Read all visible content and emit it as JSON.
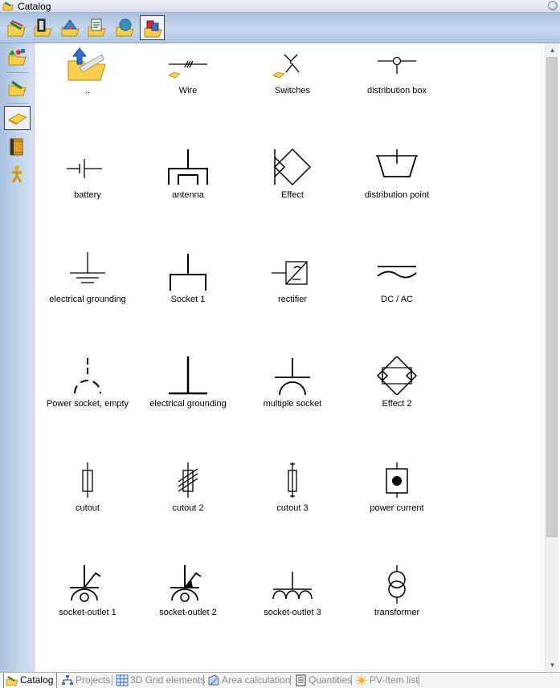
{
  "window": {
    "title": "Catalog"
  },
  "toolbar": {
    "buttons": [
      {
        "icon": "catalog-folder-icon"
      },
      {
        "icon": "door-folder-icon"
      },
      {
        "icon": "roof-folder-icon"
      },
      {
        "icon": "document-folder-icon"
      },
      {
        "icon": "globe-folder-icon"
      },
      {
        "icon": "electrical-folder-icon",
        "active": true
      }
    ]
  },
  "sidebar": {
    "buttons": [
      {
        "icon": "shapes-folder-icon"
      },
      {
        "icon": "folder-open-icon"
      },
      {
        "icon": "folder-small-icon",
        "active": true
      },
      {
        "icon": "book-icon"
      },
      {
        "icon": "person-icon"
      }
    ]
  },
  "items": [
    {
      "label": "..",
      "icon": "parent-folder-up-icon"
    },
    {
      "label": "Wire",
      "icon": "wire-symbol-icon"
    },
    {
      "label": "Switches",
      "icon": "switch-symbol-icon"
    },
    {
      "label": "distribution box",
      "icon": "distribution-box-symbol-icon"
    },
    {
      "label": "battery",
      "icon": "battery-symbol-icon"
    },
    {
      "label": "antenna",
      "icon": "antenna-symbol-icon"
    },
    {
      "label": "Effect",
      "icon": "effect-symbol-icon"
    },
    {
      "label": "distribution point",
      "icon": "distribution-point-symbol-icon"
    },
    {
      "label": "electrical grounding",
      "icon": "grounding-symbol-icon"
    },
    {
      "label": "Socket 1",
      "icon": "socket-symbol-icon"
    },
    {
      "label": "rectifier",
      "icon": "rectifier-symbol-icon"
    },
    {
      "label": "DC / AC",
      "icon": "dc-ac-symbol-icon"
    },
    {
      "label": "Power socket, empty",
      "icon": "power-socket-empty-symbol-icon"
    },
    {
      "label": "electrical grounding",
      "icon": "grounding-bar-symbol-icon"
    },
    {
      "label": "multiple socket",
      "icon": "multiple-socket-symbol-icon"
    },
    {
      "label": "Effect 2",
      "icon": "effect-2-symbol-icon"
    },
    {
      "label": "cutout",
      "icon": "cutout-symbol-icon"
    },
    {
      "label": "cutout 2",
      "icon": "cutout-2-symbol-icon"
    },
    {
      "label": "cutout 3",
      "icon": "cutout-3-symbol-icon"
    },
    {
      "label": "power current",
      "icon": "power-current-symbol-icon"
    },
    {
      "label": "socket-outlet 1",
      "icon": "socket-outlet-1-symbol-icon"
    },
    {
      "label": "socket-outlet 2",
      "icon": "socket-outlet-2-symbol-icon"
    },
    {
      "label": "socket-outlet 3",
      "icon": "socket-outlet-3-symbol-icon"
    },
    {
      "label": "transformer",
      "icon": "transformer-symbol-icon"
    }
  ],
  "tabs": [
    {
      "label": "Catalog",
      "icon": "catalog-tab-icon",
      "active": true
    },
    {
      "label": "Projects",
      "icon": "projects-tab-icon"
    },
    {
      "label": "3D Grid elements",
      "icon": "grid-tab-icon"
    },
    {
      "label": "Area calculation",
      "icon": "area-tab-icon"
    },
    {
      "label": "Quantities",
      "icon": "quantities-tab-icon"
    },
    {
      "label": "PV-Item list",
      "icon": "pv-tab-icon"
    }
  ]
}
